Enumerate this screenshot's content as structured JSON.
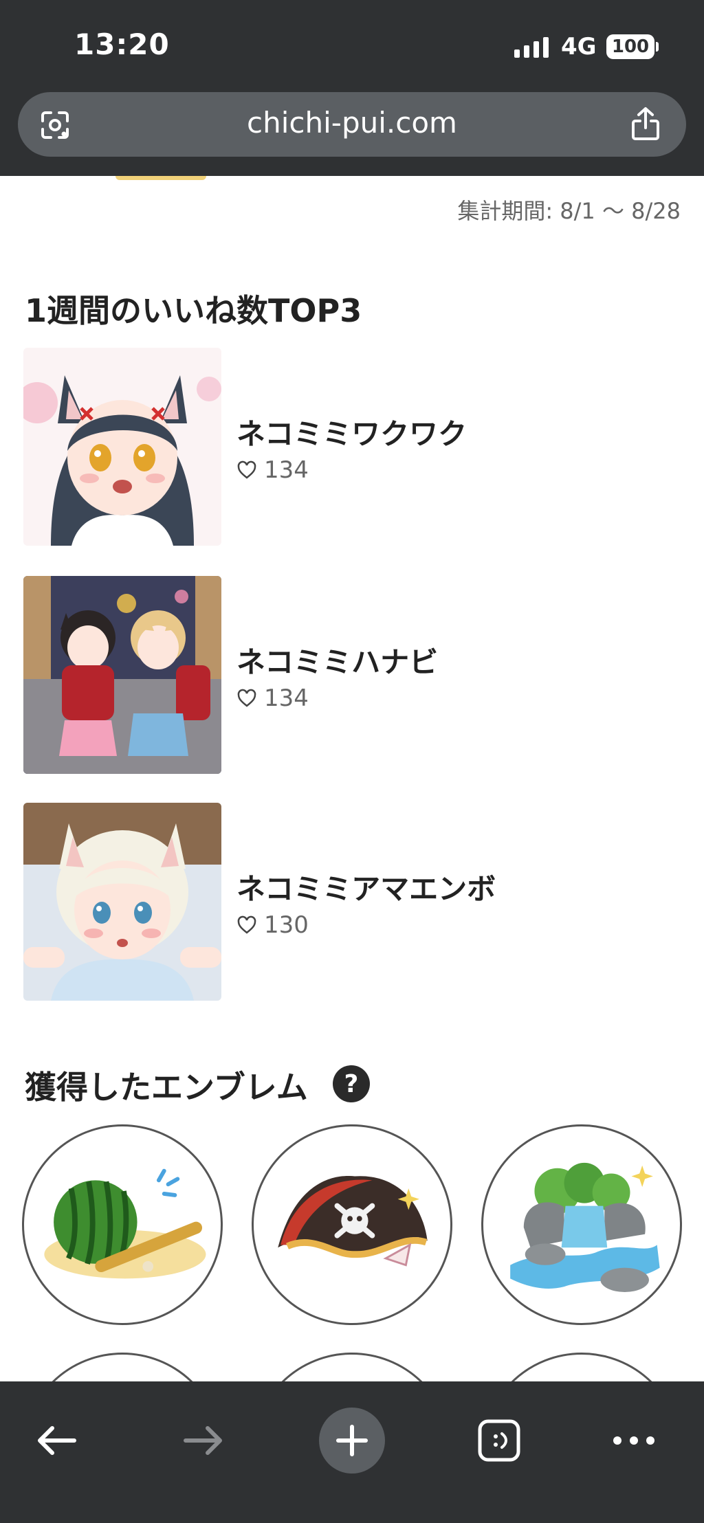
{
  "status_bar": {
    "time": "13:20",
    "network": "4G",
    "battery": "100"
  },
  "browser": {
    "url": "chichi-pui.com",
    "lens_icon": "google-lens-icon",
    "share_icon": "share-icon"
  },
  "page": {
    "period": "集計期間: 8/1 〜 8/28",
    "top3": {
      "title": "1週間のいいね数TOP3",
      "items": [
        {
          "name": "ネコミミワクワク",
          "likes": "134"
        },
        {
          "name": "ネコミミハナビ",
          "likes": "134"
        },
        {
          "name": "ネコミミアマエンボ",
          "likes": "130"
        }
      ]
    },
    "emblems": {
      "title": "獲得したエンブレム",
      "help_label": "?",
      "items": [
        {
          "icon": "watermelon-emblem-icon"
        },
        {
          "icon": "pirate-hat-emblem-icon"
        },
        {
          "icon": "waterfall-emblem-icon"
        }
      ]
    }
  },
  "toolbar": {
    "back_icon": "back-arrow-icon",
    "forward_icon": "forward-arrow-icon",
    "new_tab_icon": "plus-icon",
    "tabs_icon": "tabs-icon",
    "menu_icon": "more-icon"
  },
  "colors": {
    "chrome": "#2f3133",
    "urlbar": "#5b5f63",
    "text": "#222222",
    "muted": "#666666"
  }
}
